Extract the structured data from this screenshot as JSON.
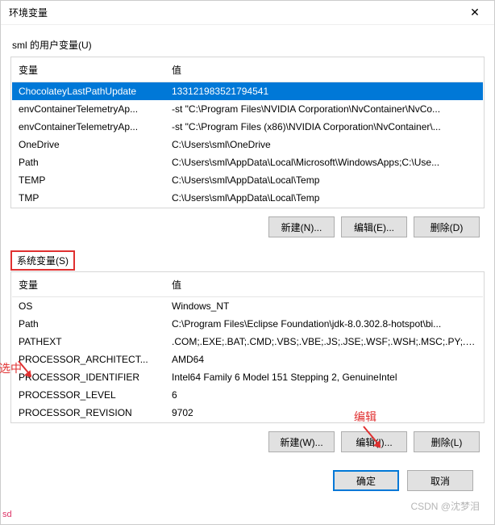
{
  "title": "环境变量",
  "close_label": "✕",
  "user_section_label": "sml 的用户变量(U)",
  "system_section_label": "系统变量(S)",
  "columns": {
    "name": "变量",
    "value": "值"
  },
  "user_vars": [
    {
      "name": "ChocolateyLastPathUpdate",
      "value": "133121983521794541",
      "selected": true
    },
    {
      "name": "envContainerTelemetryAp...",
      "value": "-st \"C:\\Program Files\\NVIDIA Corporation\\NvContainer\\NvCo...",
      "selected": false
    },
    {
      "name": "envContainerTelemetryAp...",
      "value": "-st \"C:\\Program Files (x86)\\NVIDIA Corporation\\NvContainer\\...",
      "selected": false
    },
    {
      "name": "OneDrive",
      "value": "C:\\Users\\sml\\OneDrive",
      "selected": false
    },
    {
      "name": "Path",
      "value": "C:\\Users\\sml\\AppData\\Local\\Microsoft\\WindowsApps;C:\\Use...",
      "selected": false
    },
    {
      "name": "TEMP",
      "value": "C:\\Users\\sml\\AppData\\Local\\Temp",
      "selected": false
    },
    {
      "name": "TMP",
      "value": "C:\\Users\\sml\\AppData\\Local\\Temp",
      "selected": false
    }
  ],
  "system_vars": [
    {
      "name": "OS",
      "value": "Windows_NT"
    },
    {
      "name": "Path",
      "value": "C:\\Program Files\\Eclipse Foundation\\jdk-8.0.302.8-hotspot\\bi..."
    },
    {
      "name": "PATHEXT",
      "value": ".COM;.EXE;.BAT;.CMD;.VBS;.VBE;.JS;.JSE;.WSF;.WSH;.MSC;.PY;.P..."
    },
    {
      "name": "PROCESSOR_ARCHITECT...",
      "value": "AMD64"
    },
    {
      "name": "PROCESSOR_IDENTIFIER",
      "value": "Intel64 Family 6 Model 151 Stepping 2, GenuineIntel"
    },
    {
      "name": "PROCESSOR_LEVEL",
      "value": "6"
    },
    {
      "name": "PROCESSOR_REVISION",
      "value": "9702"
    }
  ],
  "user_buttons": {
    "new": "新建(N)...",
    "edit": "编辑(E)...",
    "delete": "删除(D)"
  },
  "system_buttons": {
    "new": "新建(W)...",
    "edit": "编辑(I)...",
    "delete": "删除(L)"
  },
  "footer": {
    "ok": "确定",
    "cancel": "取消"
  },
  "annotations": {
    "select": "选中",
    "edit": "编辑"
  },
  "watermark": "CSDN @沈梦泪",
  "corner": "sd"
}
